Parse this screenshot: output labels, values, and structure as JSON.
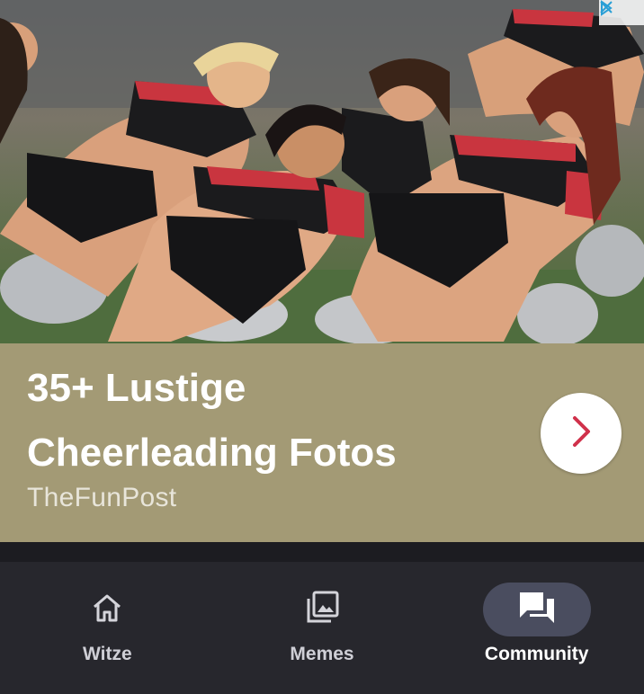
{
  "ad": {
    "title": "35+ Lustige\nCheerleading Fotos",
    "source": "TheFunPost",
    "cta_icon": "chevron-right-icon",
    "choices_icons": [
      "adchoices-icon",
      "close-icon"
    ],
    "colors": {
      "caption_bg": "#a39a75",
      "cta_arrow": "#d0314b"
    }
  },
  "nav": {
    "items": [
      {
        "label": "Witze",
        "icon": "home-icon",
        "active": false
      },
      {
        "label": "Memes",
        "icon": "image-stack-icon",
        "active": false
      },
      {
        "label": "Community",
        "icon": "forum-icon",
        "active": true
      }
    ]
  }
}
